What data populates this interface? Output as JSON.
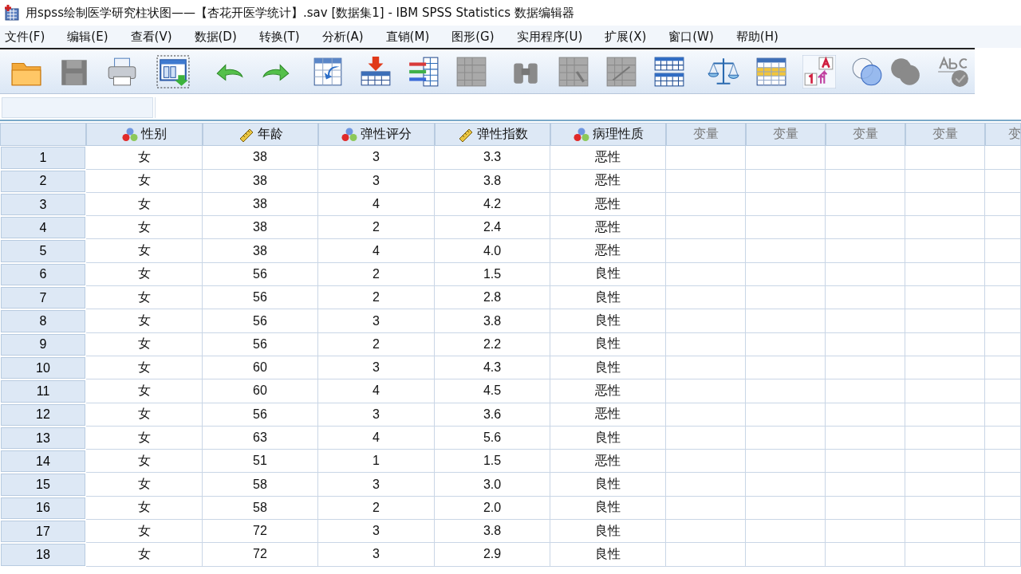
{
  "window": {
    "title": "用spss绘制医学研究柱状图——【杏花开医学统计】.sav [数据集1] - IBM SPSS Statistics 数据编辑器"
  },
  "menu": [
    "文件(F)",
    "编辑(E)",
    "查看(V)",
    "数据(D)",
    "转换(T)",
    "分析(A)",
    "直销(M)",
    "图形(G)",
    "实用程序(U)",
    "扩展(X)",
    "窗口(W)",
    "帮助(H)"
  ],
  "table": {
    "columns": [
      {
        "name": "性别",
        "kind": "nominal"
      },
      {
        "name": "年龄",
        "kind": "scale"
      },
      {
        "name": "弹性评分",
        "kind": "nominal"
      },
      {
        "name": "弹性指数",
        "kind": "scale"
      },
      {
        "name": "病理性质",
        "kind": "nominal"
      },
      {
        "name": "变量",
        "kind": "empty"
      },
      {
        "name": "变量",
        "kind": "empty"
      },
      {
        "name": "变量",
        "kind": "empty"
      },
      {
        "name": "变量",
        "kind": "empty"
      },
      {
        "name": "变",
        "kind": "empty"
      }
    ],
    "rows": [
      {
        "number": "1",
        "cells": [
          "女",
          "38",
          "3",
          "3.3",
          "恶性"
        ]
      },
      {
        "number": "2",
        "cells": [
          "女",
          "38",
          "3",
          "3.8",
          "恶性"
        ]
      },
      {
        "number": "3",
        "cells": [
          "女",
          "38",
          "4",
          "4.2",
          "恶性"
        ]
      },
      {
        "number": "4",
        "cells": [
          "女",
          "38",
          "2",
          "2.4",
          "恶性"
        ]
      },
      {
        "number": "5",
        "cells": [
          "女",
          "38",
          "4",
          "4.0",
          "恶性"
        ]
      },
      {
        "number": "6",
        "cells": [
          "女",
          "56",
          "2",
          "1.5",
          "良性"
        ]
      },
      {
        "number": "7",
        "cells": [
          "女",
          "56",
          "2",
          "2.8",
          "良性"
        ]
      },
      {
        "number": "8",
        "cells": [
          "女",
          "56",
          "3",
          "3.8",
          "良性"
        ]
      },
      {
        "number": "9",
        "cells": [
          "女",
          "56",
          "2",
          "2.2",
          "良性"
        ]
      },
      {
        "number": "10",
        "cells": [
          "女",
          "60",
          "3",
          "4.3",
          "良性"
        ]
      },
      {
        "number": "11",
        "cells": [
          "女",
          "60",
          "4",
          "4.5",
          "恶性"
        ]
      },
      {
        "number": "12",
        "cells": [
          "女",
          "56",
          "3",
          "3.6",
          "恶性"
        ]
      },
      {
        "number": "13",
        "cells": [
          "女",
          "63",
          "4",
          "5.6",
          "良性"
        ]
      },
      {
        "number": "14",
        "cells": [
          "女",
          "51",
          "1",
          "1.5",
          "恶性"
        ]
      },
      {
        "number": "15",
        "cells": [
          "女",
          "58",
          "3",
          "3.0",
          "良性"
        ]
      },
      {
        "number": "16",
        "cells": [
          "女",
          "58",
          "2",
          "2.0",
          "良性"
        ]
      },
      {
        "number": "17",
        "cells": [
          "女",
          "72",
          "3",
          "3.8",
          "良性"
        ]
      },
      {
        "number": "18",
        "cells": [
          "女",
          "72",
          "3",
          "2.9",
          "良性"
        ]
      }
    ]
  }
}
